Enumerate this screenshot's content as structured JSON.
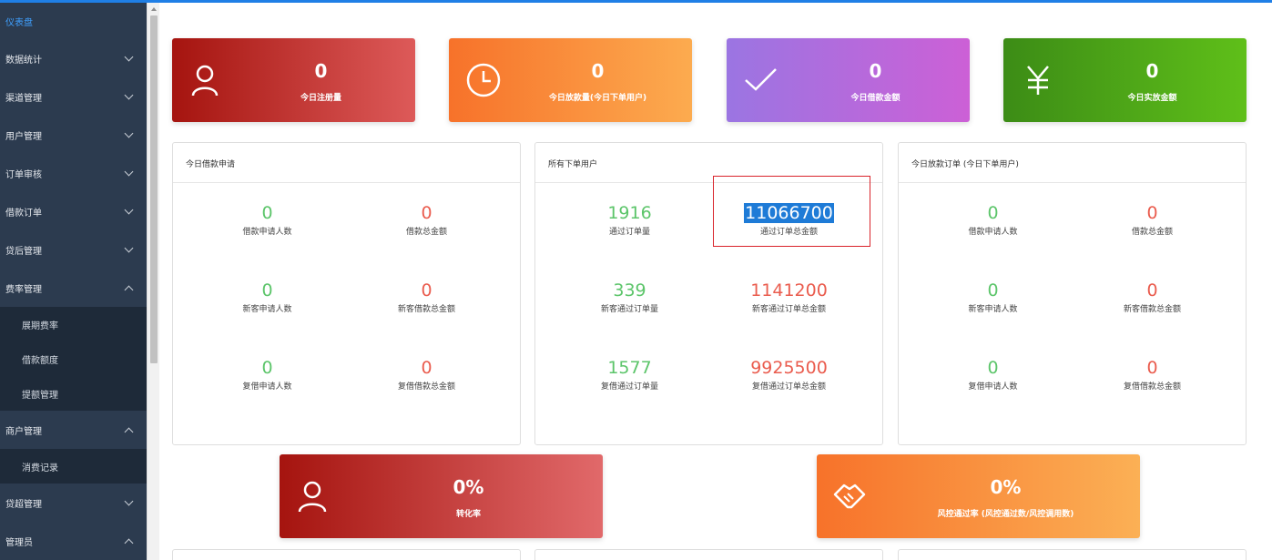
{
  "sidebar": {
    "items": [
      {
        "label": "仪表盘",
        "chevron": "none",
        "active": true
      },
      {
        "label": "数据统计",
        "chevron": "down"
      },
      {
        "label": "渠道管理",
        "chevron": "down"
      },
      {
        "label": "用户管理",
        "chevron": "down"
      },
      {
        "label": "订单审核",
        "chevron": "down"
      },
      {
        "label": "借款订单",
        "chevron": "down"
      },
      {
        "label": "贷后管理",
        "chevron": "down"
      },
      {
        "label": "费率管理",
        "chevron": "up",
        "children": [
          "展期费率",
          "借款额度",
          "提额管理"
        ]
      },
      {
        "label": "商户管理",
        "chevron": "up",
        "children": [
          "消费记录"
        ]
      },
      {
        "label": "贷超管理",
        "chevron": "down"
      },
      {
        "label": "管理员",
        "chevron": "up"
      }
    ]
  },
  "stat_cards": [
    {
      "value": "0",
      "label": "今日注册量",
      "icon": "user-icon"
    },
    {
      "value": "0",
      "label": "今日放款量(今日下单用户)",
      "icon": "clock-icon"
    },
    {
      "value": "0",
      "label": "今日借款金额",
      "icon": "check-icon"
    },
    {
      "value": "0",
      "label": "今日实放金额",
      "icon": "yuan-icon"
    }
  ],
  "panels": [
    {
      "title": "今日借款申请",
      "metrics": [
        {
          "value": "0",
          "label": "借款申请人数",
          "color": "green"
        },
        {
          "value": "0",
          "label": "借款总金额",
          "color": "red"
        },
        {
          "value": "0",
          "label": "新客申请人数",
          "color": "green"
        },
        {
          "value": "0",
          "label": "新客借款总金额",
          "color": "red"
        },
        {
          "value": "0",
          "label": "复借申请人数",
          "color": "green"
        },
        {
          "value": "0",
          "label": "复借借款总金额",
          "color": "red"
        }
      ]
    },
    {
      "title": "所有下单用户",
      "metrics": [
        {
          "value": "1916",
          "label": "通过订单量",
          "color": "green"
        },
        {
          "value": "11066700",
          "label": "通过订单总金额",
          "color": "red",
          "highlighted": true
        },
        {
          "value": "339",
          "label": "新客通过订单量",
          "color": "green"
        },
        {
          "value": "1141200",
          "label": "新客通过订单总金额",
          "color": "red"
        },
        {
          "value": "1577",
          "label": "复借通过订单量",
          "color": "green"
        },
        {
          "value": "9925500",
          "label": "复借通过订单总金额",
          "color": "red"
        }
      ]
    },
    {
      "title": "今日放款订单 (今日下单用户)",
      "metrics": [
        {
          "value": "0",
          "label": "借款申请人数",
          "color": "green"
        },
        {
          "value": "0",
          "label": "借款总金额",
          "color": "red"
        },
        {
          "value": "0",
          "label": "新客申请人数",
          "color": "green"
        },
        {
          "value": "0",
          "label": "新客借款总金额",
          "color": "red"
        },
        {
          "value": "0",
          "label": "复借申请人数",
          "color": "green"
        },
        {
          "value": "0",
          "label": "复借借款总金额",
          "color": "red"
        }
      ]
    }
  ],
  "bottom_cards": [
    {
      "value": "0%",
      "label": "转化率",
      "icon": "user-icon"
    },
    {
      "value": "0%",
      "label": "风控通过率 (风控通过数/风控调用数)",
      "icon": "handshake-icon"
    }
  ],
  "colors": {
    "accent": "#1f7fe6",
    "sidebar_bg": "#2c3b4f",
    "value_green": "#5cc56a",
    "value_red": "#ea5c4e"
  }
}
